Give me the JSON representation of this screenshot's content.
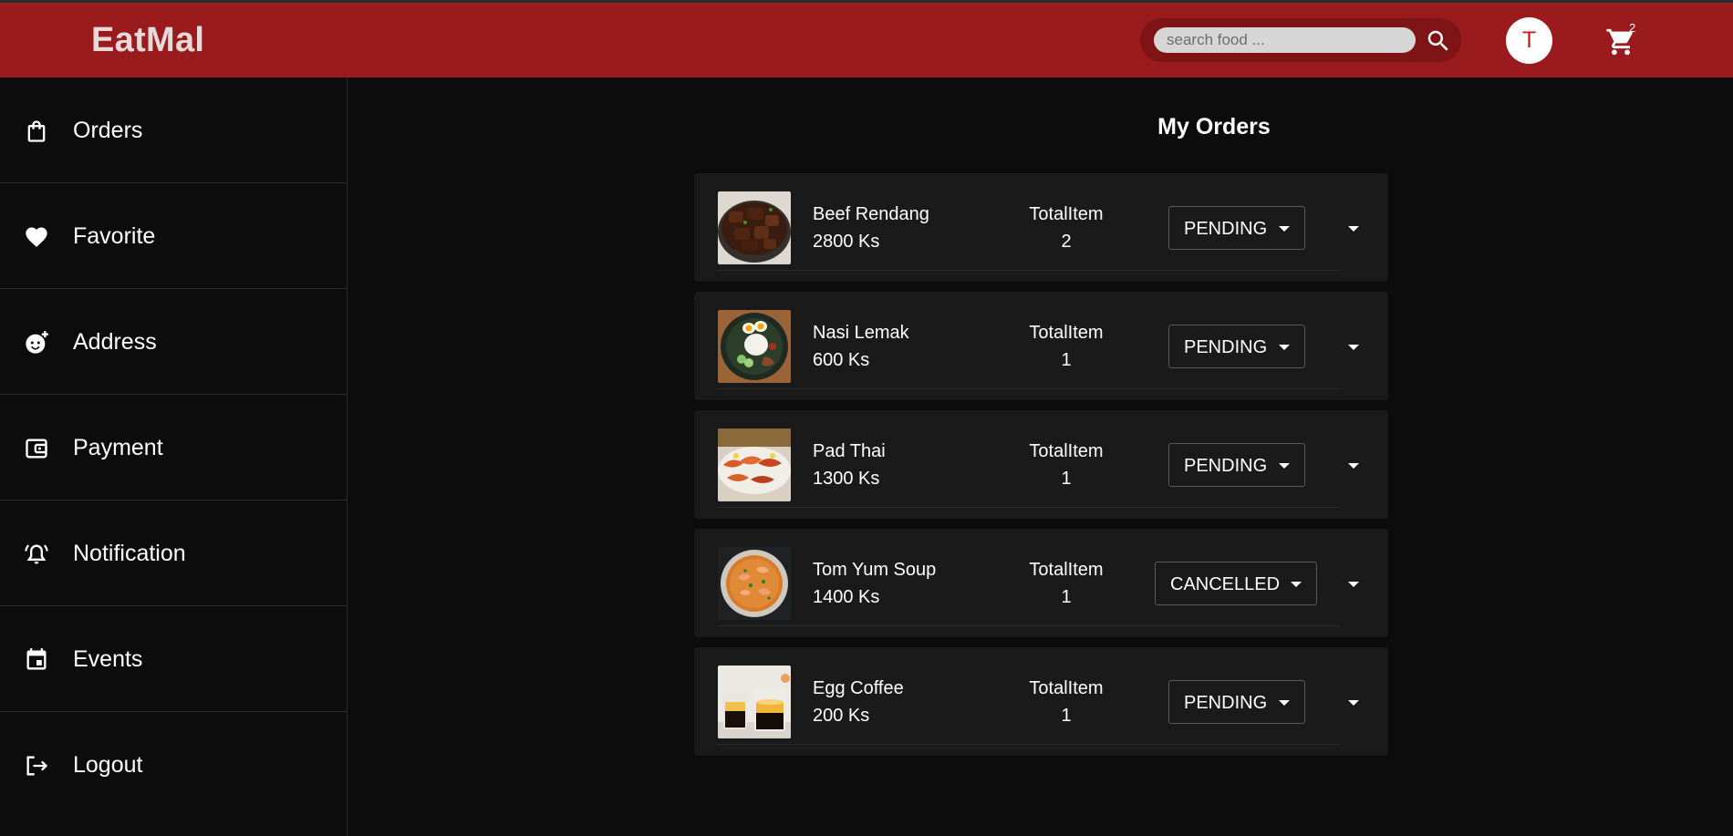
{
  "app": {
    "title": "EatMal"
  },
  "header": {
    "search": {
      "placeholder": "search food ...",
      "value": ""
    },
    "avatar_initial": "T",
    "cart_count": "2"
  },
  "sidebar": {
    "items": [
      {
        "label": "Orders",
        "icon": "shopping-bag-icon"
      },
      {
        "label": "Favorite",
        "icon": "heart-icon"
      },
      {
        "label": "Address",
        "icon": "face-add-icon"
      },
      {
        "label": "Payment",
        "icon": "wallet-icon"
      },
      {
        "label": "Notification",
        "icon": "bell-alert-icon"
      },
      {
        "label": "Events",
        "icon": "calendar-event-icon"
      },
      {
        "label": "Logout",
        "icon": "logout-icon"
      }
    ]
  },
  "main": {
    "title": "My Orders",
    "total_item_label": "TotalItem",
    "orders": [
      {
        "name": "Beef Rendang",
        "price": "2800 Ks",
        "total_items": "2",
        "status": "PENDING",
        "image": "beef-rendang-photo"
      },
      {
        "name": "Nasi Lemak",
        "price": "600 Ks",
        "total_items": "1",
        "status": "PENDING",
        "image": "nasi-lemak-photo"
      },
      {
        "name": "Pad Thai",
        "price": "1300 Ks",
        "total_items": "1",
        "status": "PENDING",
        "image": "pad-thai-photo"
      },
      {
        "name": "Tom Yum Soup",
        "price": "1400 Ks",
        "total_items": "1",
        "status": "CANCELLED",
        "image": "tom-yum-soup-photo"
      },
      {
        "name": "Egg Coffee",
        "price": "200 Ks",
        "total_items": "1",
        "status": "PENDING",
        "image": "egg-coffee-photo"
      }
    ]
  },
  "colors": {
    "header_bg": "#991b1e",
    "page_bg": "#0c0c0c",
    "card_bg": "#1a1a1a",
    "avatar_text": "#c42020"
  }
}
